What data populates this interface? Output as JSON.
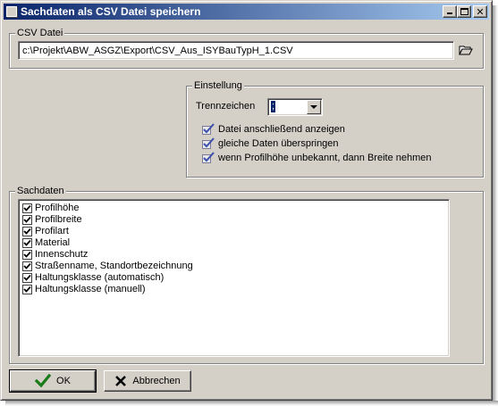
{
  "window": {
    "title": "Sachdaten als CSV Datei speichern"
  },
  "csv_group": {
    "label": "CSV Datei",
    "path_value": "c:\\Projekt\\ABW_ASGZ\\Export\\CSV_Aus_ISYBauTypH_1.CSV",
    "browse_icon": "folder-open-icon"
  },
  "einstellung": {
    "label": "Einstellung",
    "trennzeichen_label": "Trennzeichen",
    "trennzeichen_value": ";",
    "options": [
      {
        "label": "Datei anschließend anzeigen",
        "checked": true
      },
      {
        "label": "gleiche Daten überspringen",
        "checked": true
      },
      {
        "label": "wenn Profilhöhe unbekannt, dann Breite nehmen",
        "checked": true
      }
    ]
  },
  "sachdaten": {
    "label": "Sachdaten",
    "items": [
      {
        "label": "Profilhöhe",
        "checked": true
      },
      {
        "label": "Profilbreite",
        "checked": true
      },
      {
        "label": "Profilart",
        "checked": true
      },
      {
        "label": "Material",
        "checked": true
      },
      {
        "label": "Innenschutz",
        "checked": true
      },
      {
        "label": "Straßenname, Standortbezeichnung",
        "checked": true
      },
      {
        "label": "Haltungsklasse (automatisch)",
        "checked": true
      },
      {
        "label": "Haltungsklasse (manuell)",
        "checked": true
      }
    ]
  },
  "buttons": {
    "ok_label": "OK",
    "cancel_label": "Abbrechen"
  },
  "colors": {
    "title_start": "#0a246a",
    "title_end": "#a6caf0",
    "face": "#d4d0c8",
    "check_green": "#1a7a1a"
  }
}
